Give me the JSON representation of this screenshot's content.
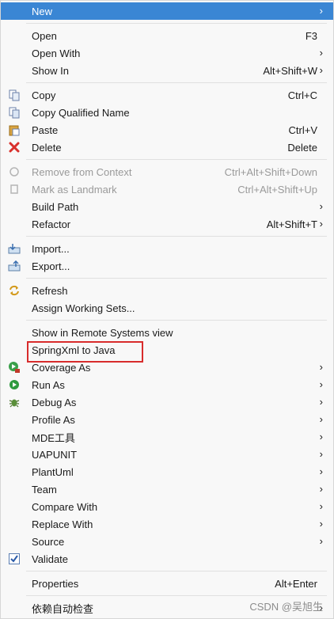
{
  "menu": {
    "new": {
      "label": "New"
    },
    "open": {
      "label": "Open",
      "shortcut": "F3"
    },
    "open_with": {
      "label": "Open With"
    },
    "show_in": {
      "label": "Show In",
      "shortcut": "Alt+Shift+W"
    },
    "copy": {
      "label": "Copy",
      "shortcut": "Ctrl+C"
    },
    "copy_qualified": {
      "label": "Copy Qualified Name"
    },
    "paste": {
      "label": "Paste",
      "shortcut": "Ctrl+V"
    },
    "delete": {
      "label": "Delete",
      "shortcut": "Delete"
    },
    "remove_context": {
      "label": "Remove from Context",
      "shortcut": "Ctrl+Alt+Shift+Down"
    },
    "mark_landmark": {
      "label": "Mark as Landmark",
      "shortcut": "Ctrl+Alt+Shift+Up"
    },
    "build_path": {
      "label": "Build Path"
    },
    "refactor": {
      "label": "Refactor",
      "shortcut": "Alt+Shift+T"
    },
    "import": {
      "label": "Import..."
    },
    "export": {
      "label": "Export..."
    },
    "refresh": {
      "label": "Refresh"
    },
    "assign_sets": {
      "label": "Assign Working Sets..."
    },
    "remote_systems": {
      "label": "Show in Remote Systems view"
    },
    "springxml": {
      "label": "SpringXml to Java"
    },
    "coverage": {
      "label": "Coverage As"
    },
    "run_as": {
      "label": "Run As"
    },
    "debug_as": {
      "label": "Debug As"
    },
    "profile_as": {
      "label": "Profile As"
    },
    "mde": {
      "label": "MDE工具"
    },
    "uapunit": {
      "label": "UAPUNIT"
    },
    "plantuml": {
      "label": "PlantUml"
    },
    "team": {
      "label": "Team"
    },
    "compare": {
      "label": "Compare With"
    },
    "replace": {
      "label": "Replace With"
    },
    "source": {
      "label": "Source"
    },
    "validate": {
      "label": "Validate"
    },
    "properties": {
      "label": "Properties",
      "shortcut": "Alt+Enter"
    },
    "auto_check": {
      "label": "依赖自动检查"
    }
  },
  "watermark": "CSDN @吴旭生",
  "colors": {
    "highlight": "#3a86d4",
    "annotation_box": "#d82c2c"
  }
}
